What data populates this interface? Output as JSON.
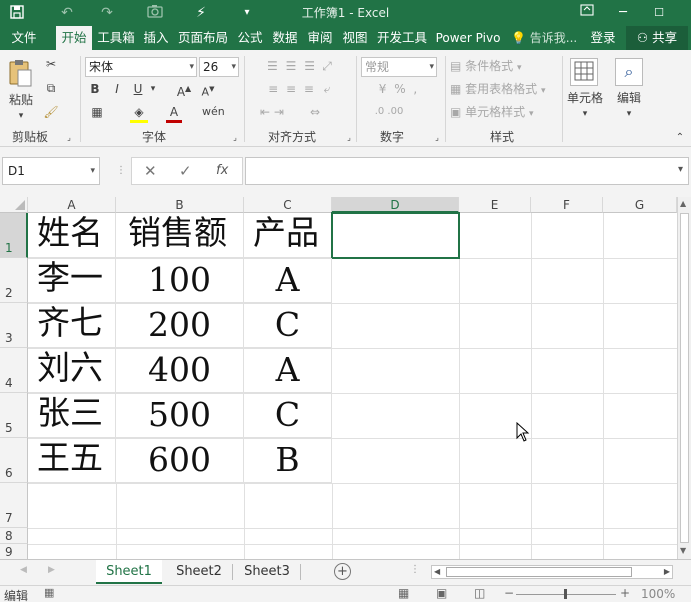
{
  "app": {
    "title": "工作簿1 - Excel",
    "accent": "#217346"
  },
  "ribbon_tabs": [
    {
      "label": "文件"
    },
    {
      "label": "开始"
    },
    {
      "label": "工具箱"
    },
    {
      "label": "插入"
    },
    {
      "label": "页面布局"
    },
    {
      "label": "公式"
    },
    {
      "label": "数据"
    },
    {
      "label": "审阅"
    },
    {
      "label": "视图"
    },
    {
      "label": "开发工具"
    },
    {
      "label": "Power Pivo"
    }
  ],
  "tell_me": "告诉我...",
  "login": "登录",
  "share": "共享",
  "ribbon": {
    "paste": "粘贴",
    "font_name": "宋体",
    "font_size": "26",
    "number_format": "常规",
    "cond_format": "条件格式",
    "table_format": "套用表格格式",
    "cell_style": "单元格样式",
    "cells": "单元格",
    "edit": "编辑",
    "groups": {
      "clipboard": "剪贴板",
      "font": "字体",
      "alignment": "对齐方式",
      "number": "数字",
      "styles": "样式"
    }
  },
  "formula_bar": {
    "name_box": "D1",
    "fx": "fx",
    "content": ""
  },
  "columns": [
    "A",
    "B",
    "C",
    "D",
    "E",
    "F",
    "G"
  ],
  "rows": [
    "1",
    "2",
    "3",
    "4",
    "5",
    "6",
    "7",
    "8",
    "9"
  ],
  "cells": {
    "r1": [
      "姓名",
      "销售额",
      "产品"
    ],
    "r2": [
      "李一",
      "100",
      "A"
    ],
    "r3": [
      "齐七",
      "200",
      "C"
    ],
    "r4": [
      "刘六",
      "400",
      "A"
    ],
    "r5": [
      "张三",
      "500",
      "C"
    ],
    "r6": [
      "王五",
      "600",
      "B"
    ]
  },
  "sheets": [
    {
      "label": "Sheet1"
    },
    {
      "label": "Sheet2"
    },
    {
      "label": "Sheet3"
    }
  ],
  "status": {
    "mode": "编辑",
    "zoom": "100%"
  }
}
